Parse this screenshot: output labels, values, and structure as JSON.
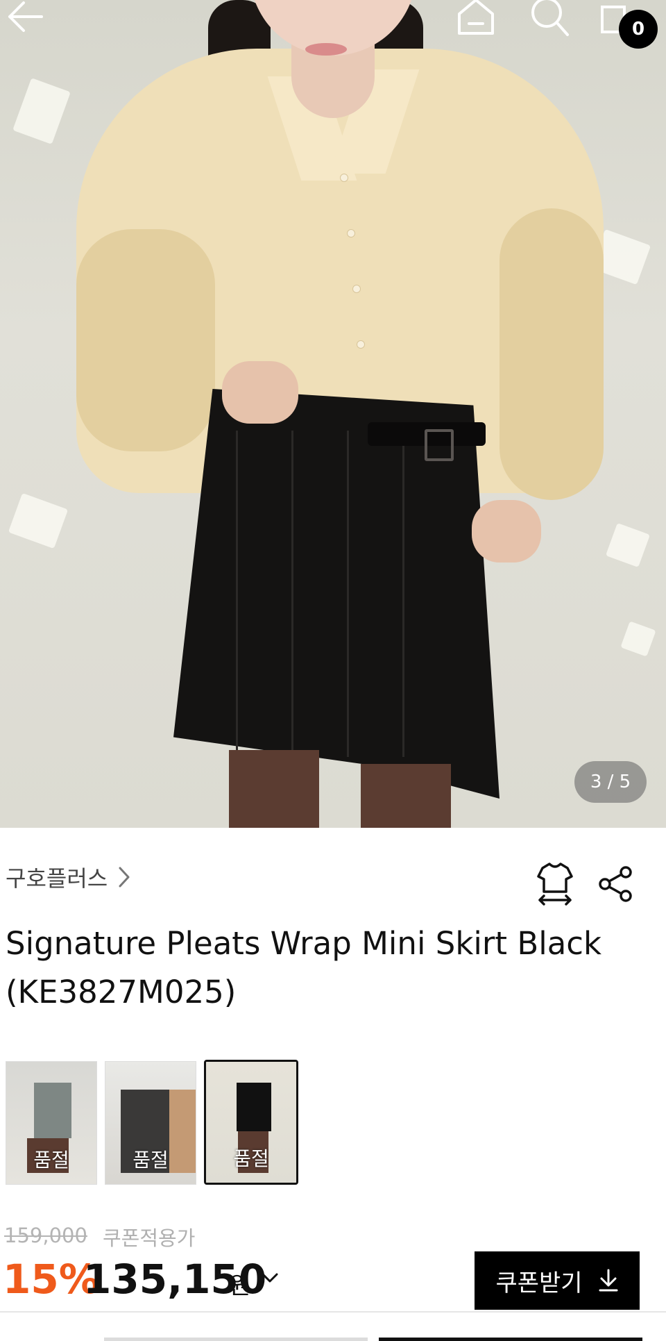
{
  "product_image": {
    "counter": "3 / 5"
  },
  "header": {
    "cart_count": "0"
  },
  "brand": {
    "name": "구호플러스"
  },
  "product": {
    "title": "Signature Pleats Wrap Mini Skirt Black (KE3827M025)"
  },
  "color_options": [
    {
      "status": "품절",
      "swatch": "gray"
    },
    {
      "status": "품절",
      "swatch": "charcoal"
    },
    {
      "status": "품절",
      "swatch": "black",
      "selected": true
    }
  ],
  "pricing": {
    "original_price": "159,000",
    "coupon_label": "쿠폰적용가",
    "discount": "15%",
    "price": "135,150",
    "currency": "원",
    "coupon_button": "쿠폰받기"
  },
  "colors": {
    "accent": "#ef5a1b",
    "button_bg": "#000000"
  }
}
